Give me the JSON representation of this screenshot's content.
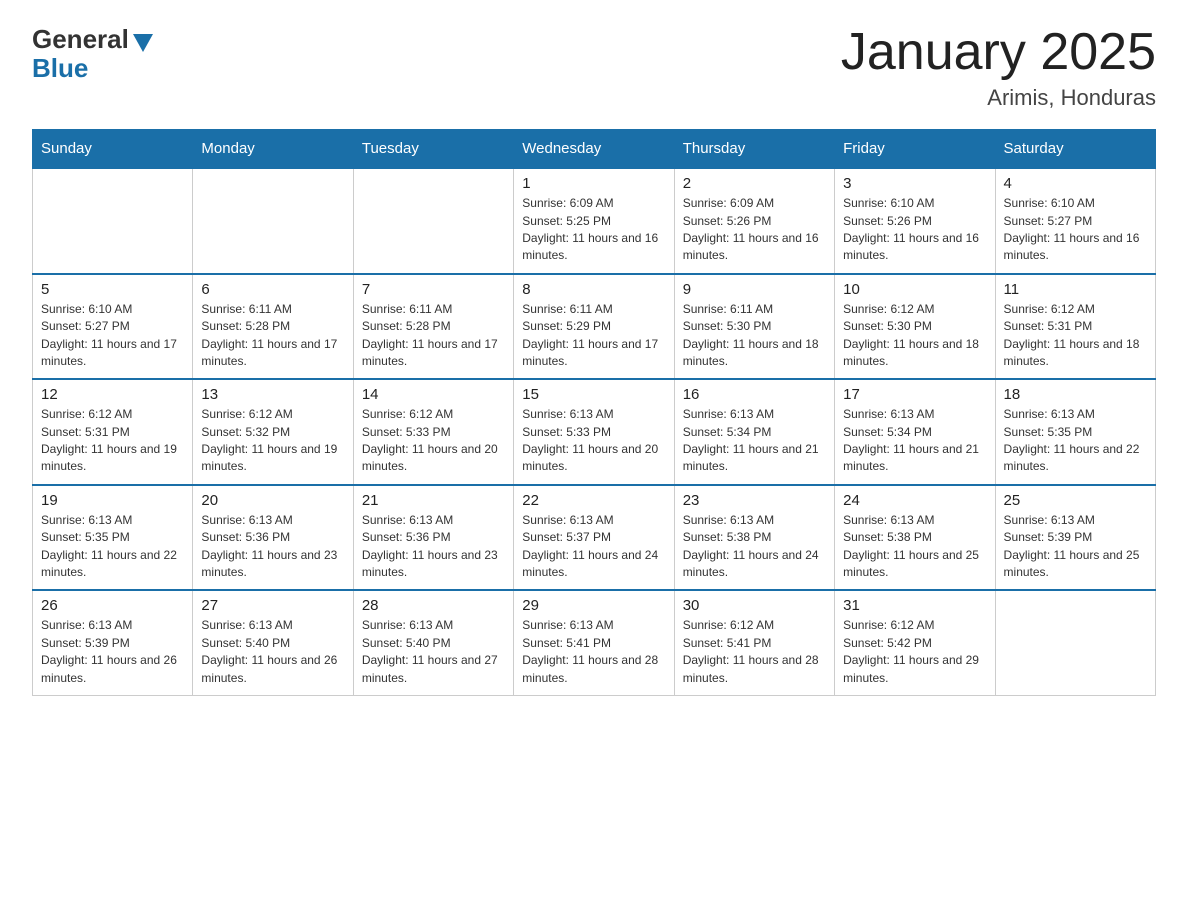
{
  "logo": {
    "general": "General",
    "blue": "Blue"
  },
  "title": "January 2025",
  "subtitle": "Arimis, Honduras",
  "days_header": [
    "Sunday",
    "Monday",
    "Tuesday",
    "Wednesday",
    "Thursday",
    "Friday",
    "Saturday"
  ],
  "weeks": [
    [
      {
        "num": "",
        "info": ""
      },
      {
        "num": "",
        "info": ""
      },
      {
        "num": "",
        "info": ""
      },
      {
        "num": "1",
        "info": "Sunrise: 6:09 AM\nSunset: 5:25 PM\nDaylight: 11 hours and 16 minutes."
      },
      {
        "num": "2",
        "info": "Sunrise: 6:09 AM\nSunset: 5:26 PM\nDaylight: 11 hours and 16 minutes."
      },
      {
        "num": "3",
        "info": "Sunrise: 6:10 AM\nSunset: 5:26 PM\nDaylight: 11 hours and 16 minutes."
      },
      {
        "num": "4",
        "info": "Sunrise: 6:10 AM\nSunset: 5:27 PM\nDaylight: 11 hours and 16 minutes."
      }
    ],
    [
      {
        "num": "5",
        "info": "Sunrise: 6:10 AM\nSunset: 5:27 PM\nDaylight: 11 hours and 17 minutes."
      },
      {
        "num": "6",
        "info": "Sunrise: 6:11 AM\nSunset: 5:28 PM\nDaylight: 11 hours and 17 minutes."
      },
      {
        "num": "7",
        "info": "Sunrise: 6:11 AM\nSunset: 5:28 PM\nDaylight: 11 hours and 17 minutes."
      },
      {
        "num": "8",
        "info": "Sunrise: 6:11 AM\nSunset: 5:29 PM\nDaylight: 11 hours and 17 minutes."
      },
      {
        "num": "9",
        "info": "Sunrise: 6:11 AM\nSunset: 5:30 PM\nDaylight: 11 hours and 18 minutes."
      },
      {
        "num": "10",
        "info": "Sunrise: 6:12 AM\nSunset: 5:30 PM\nDaylight: 11 hours and 18 minutes."
      },
      {
        "num": "11",
        "info": "Sunrise: 6:12 AM\nSunset: 5:31 PM\nDaylight: 11 hours and 18 minutes."
      }
    ],
    [
      {
        "num": "12",
        "info": "Sunrise: 6:12 AM\nSunset: 5:31 PM\nDaylight: 11 hours and 19 minutes."
      },
      {
        "num": "13",
        "info": "Sunrise: 6:12 AM\nSunset: 5:32 PM\nDaylight: 11 hours and 19 minutes."
      },
      {
        "num": "14",
        "info": "Sunrise: 6:12 AM\nSunset: 5:33 PM\nDaylight: 11 hours and 20 minutes."
      },
      {
        "num": "15",
        "info": "Sunrise: 6:13 AM\nSunset: 5:33 PM\nDaylight: 11 hours and 20 minutes."
      },
      {
        "num": "16",
        "info": "Sunrise: 6:13 AM\nSunset: 5:34 PM\nDaylight: 11 hours and 21 minutes."
      },
      {
        "num": "17",
        "info": "Sunrise: 6:13 AM\nSunset: 5:34 PM\nDaylight: 11 hours and 21 minutes."
      },
      {
        "num": "18",
        "info": "Sunrise: 6:13 AM\nSunset: 5:35 PM\nDaylight: 11 hours and 22 minutes."
      }
    ],
    [
      {
        "num": "19",
        "info": "Sunrise: 6:13 AM\nSunset: 5:35 PM\nDaylight: 11 hours and 22 minutes."
      },
      {
        "num": "20",
        "info": "Sunrise: 6:13 AM\nSunset: 5:36 PM\nDaylight: 11 hours and 23 minutes."
      },
      {
        "num": "21",
        "info": "Sunrise: 6:13 AM\nSunset: 5:36 PM\nDaylight: 11 hours and 23 minutes."
      },
      {
        "num": "22",
        "info": "Sunrise: 6:13 AM\nSunset: 5:37 PM\nDaylight: 11 hours and 24 minutes."
      },
      {
        "num": "23",
        "info": "Sunrise: 6:13 AM\nSunset: 5:38 PM\nDaylight: 11 hours and 24 minutes."
      },
      {
        "num": "24",
        "info": "Sunrise: 6:13 AM\nSunset: 5:38 PM\nDaylight: 11 hours and 25 minutes."
      },
      {
        "num": "25",
        "info": "Sunrise: 6:13 AM\nSunset: 5:39 PM\nDaylight: 11 hours and 25 minutes."
      }
    ],
    [
      {
        "num": "26",
        "info": "Sunrise: 6:13 AM\nSunset: 5:39 PM\nDaylight: 11 hours and 26 minutes."
      },
      {
        "num": "27",
        "info": "Sunrise: 6:13 AM\nSunset: 5:40 PM\nDaylight: 11 hours and 26 minutes."
      },
      {
        "num": "28",
        "info": "Sunrise: 6:13 AM\nSunset: 5:40 PM\nDaylight: 11 hours and 27 minutes."
      },
      {
        "num": "29",
        "info": "Sunrise: 6:13 AM\nSunset: 5:41 PM\nDaylight: 11 hours and 28 minutes."
      },
      {
        "num": "30",
        "info": "Sunrise: 6:12 AM\nSunset: 5:41 PM\nDaylight: 11 hours and 28 minutes."
      },
      {
        "num": "31",
        "info": "Sunrise: 6:12 AM\nSunset: 5:42 PM\nDaylight: 11 hours and 29 minutes."
      },
      {
        "num": "",
        "info": ""
      }
    ]
  ]
}
